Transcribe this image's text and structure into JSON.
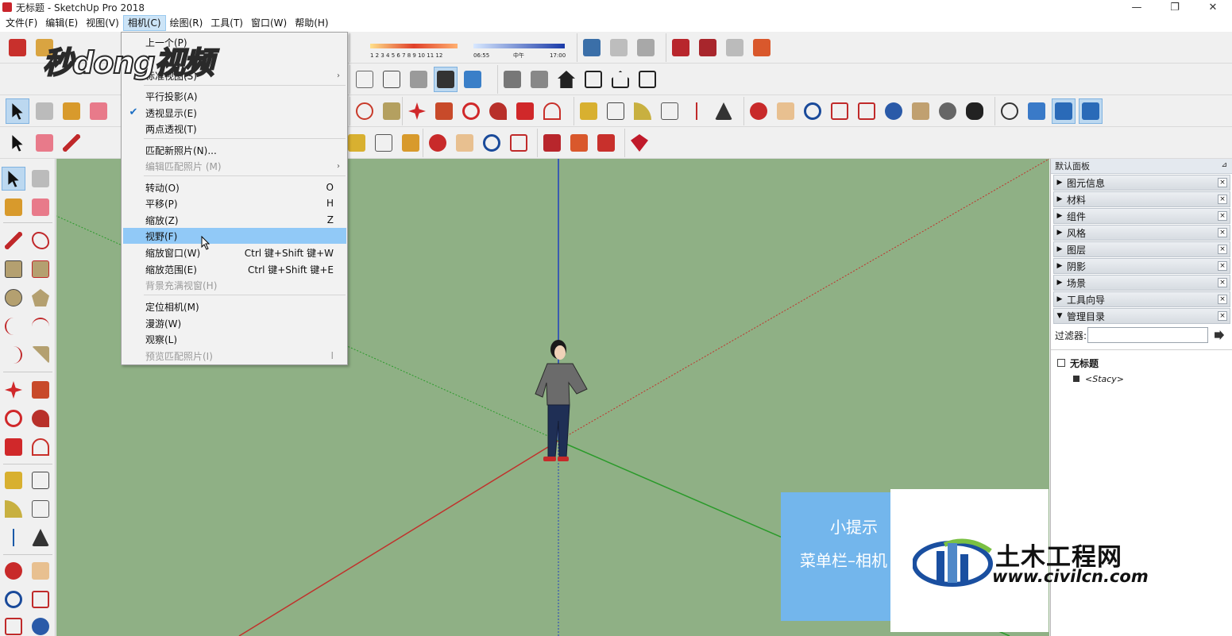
{
  "window": {
    "title": "无标题 - SketchUp Pro 2018",
    "minimize": "—",
    "restore": "❐",
    "close": "✕"
  },
  "menubar": [
    {
      "label": "文件(F)"
    },
    {
      "label": "编辑(E)"
    },
    {
      "label": "视图(V)"
    },
    {
      "label": "相机(C)"
    },
    {
      "label": "绘图(R)"
    },
    {
      "label": "工具(T)"
    },
    {
      "label": "窗口(W)"
    },
    {
      "label": "帮助(H)"
    }
  ],
  "camera_menu": {
    "items": [
      {
        "label": "上一个(P)",
        "shortcut": "",
        "state": "partial"
      },
      {
        "label": "标准视图(S)",
        "shortcut": "",
        "state": "partial"
      },
      {
        "label": "平行投影(A)",
        "shortcut": ""
      },
      {
        "label": "透视显示(E)",
        "shortcut": ""
      },
      {
        "label": "两点透视(T)",
        "shortcut": ""
      },
      {
        "label": "匹配新照片(N)...",
        "shortcut": ""
      },
      {
        "label": "编辑匹配照片 (M)",
        "shortcut": ""
      },
      {
        "label": "转动(O)",
        "shortcut": "O"
      },
      {
        "label": "平移(P)",
        "shortcut": "H"
      },
      {
        "label": "缩放(Z)",
        "shortcut": "Z"
      },
      {
        "label": "视野(F)",
        "shortcut": ""
      },
      {
        "label": "缩放窗口(W)",
        "shortcut": "Ctrl 键+Shift 键+W"
      },
      {
        "label": "缩放范围(E)",
        "shortcut": "Ctrl 键+Shift 键+E"
      },
      {
        "label": "背景充满视窗(H)",
        "shortcut": ""
      },
      {
        "label": "定位相机(M)",
        "shortcut": ""
      },
      {
        "label": "漫游(W)",
        "shortcut": ""
      },
      {
        "label": "观察(L)",
        "shortcut": ""
      },
      {
        "label": "预览匹配照片(I)",
        "shortcut": "I"
      }
    ]
  },
  "shadow_toolbar": {
    "months": "1 2 3 4 5 6 7 8 9 10 11 12",
    "time_start": "06:55",
    "time_mid": "中午",
    "time_end": "17:00"
  },
  "tray": {
    "title": "默认面板",
    "panels": [
      {
        "name": "图元信息",
        "arrow": "▶"
      },
      {
        "name": "材料",
        "arrow": "▶"
      },
      {
        "name": "组件",
        "arrow": "▶"
      },
      {
        "name": "风格",
        "arrow": "▶"
      },
      {
        "name": "图层",
        "arrow": "▶"
      },
      {
        "name": "阴影",
        "arrow": "▶"
      },
      {
        "name": "场景",
        "arrow": "▶"
      },
      {
        "name": "工具向导",
        "arrow": "▶"
      },
      {
        "name": "管理目录",
        "arrow": "▼"
      }
    ],
    "close_glyph": "×",
    "filter_label": "过滤器:",
    "filter_value": "",
    "outliner_root": "无标题",
    "outliner_child": "<Stacy>"
  },
  "overlays": {
    "watermark": "秒dong视频",
    "tip_title": "小提示",
    "tip_body": "菜单栏–相机",
    "logo_cn": "土木工程网",
    "logo_url": "www.civilcn.com"
  },
  "colors": {
    "viewport_bg": "#8fb085",
    "axis_blue": "#1f3fbf",
    "axis_red": "#c0322c",
    "axis_green": "#2a9a2a",
    "menu_highlight": "#91c9f7",
    "tip_blue": "#73b6ec"
  }
}
